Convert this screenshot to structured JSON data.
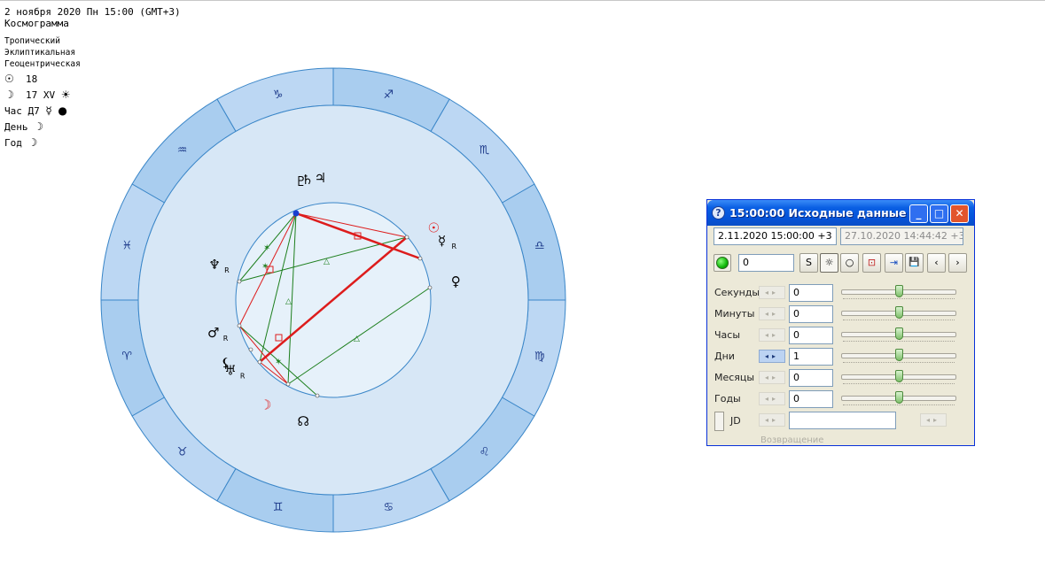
{
  "header": {
    "date_line": "2 ноября 2020  Пн  15:00 (GMT+3)",
    "chart_kind": "Космограмма",
    "zodiac": "Тропический",
    "coords": "Эклиптикальная",
    "center": "Геоцентрическая",
    "sun_line": {
      "glyph": "☉",
      "value": "18"
    },
    "moon_line": {
      "glyph": "☽",
      "value": "17 XV",
      "extra": "☀"
    },
    "hour_line": {
      "label": "Час Д7",
      "glyph": "☿",
      "dot": "●"
    },
    "day_line": {
      "label": "День",
      "glyph": "☽"
    },
    "year_line": {
      "label": "Год",
      "glyph": "☽"
    }
  },
  "wheel": {
    "signs": [
      {
        "name": "capricorn-icon",
        "glyph": "♑",
        "angle": 105
      },
      {
        "name": "sagittarius-icon",
        "glyph": "♐",
        "angle": 75
      },
      {
        "name": "scorpio-icon",
        "glyph": "♏",
        "angle": 45
      },
      {
        "name": "libra-icon",
        "glyph": "♎",
        "angle": 15
      },
      {
        "name": "virgo-icon",
        "glyph": "♍",
        "angle": -15
      },
      {
        "name": "leo-icon",
        "glyph": "♌",
        "angle": -45
      },
      {
        "name": "cancer-icon",
        "glyph": "♋",
        "angle": -75
      },
      {
        "name": "gemini-icon",
        "glyph": "♊",
        "angle": -105
      },
      {
        "name": "taurus-icon",
        "glyph": "♉",
        "angle": -135
      },
      {
        "name": "aries-icon",
        "glyph": "♈",
        "angle": -165
      },
      {
        "name": "pisces-icon",
        "glyph": "♓",
        "angle": 165
      },
      {
        "name": "aquarius-icon",
        "glyph": "♒",
        "angle": 135
      }
    ],
    "planets": [
      {
        "name": "pluto-icon",
        "glyph": "♇",
        "angle": 105,
        "color": "#000000"
      },
      {
        "name": "saturn-icon",
        "glyph": "♄",
        "angle": 102,
        "color": "#000000"
      },
      {
        "name": "jupiter-icon",
        "glyph": "♃",
        "angle": 96,
        "color": "#000000"
      },
      {
        "name": "sun-icon",
        "glyph": "☉",
        "angle": 36,
        "color": "#e02020"
      },
      {
        "name": "mercury-icon",
        "glyph": "☿",
        "angle": 29,
        "retro": "R",
        "color": "#000000"
      },
      {
        "name": "venus-icon",
        "glyph": "♀",
        "angle": 9,
        "color": "#000000"
      },
      {
        "name": "neptune-icon",
        "glyph": "♆",
        "angle": 163,
        "retro": "R",
        "color": "#000000"
      },
      {
        "name": "mars-icon",
        "glyph": "♂",
        "angle": 195,
        "retro": "R",
        "color": "#000000"
      },
      {
        "name": "lilith-icon",
        "glyph": "⚸",
        "angle": 210,
        "color": "#000000"
      },
      {
        "name": "uranus-icon",
        "glyph": "♅",
        "angle": 214,
        "retro": "R",
        "color": "#000000"
      },
      {
        "name": "moon-icon",
        "glyph": "☽",
        "angle": 237,
        "color": "#e02020"
      },
      {
        "name": "north-node-icon",
        "glyph": "☊",
        "angle": 256,
        "color": "#000000"
      }
    ],
    "colors": {
      "outer_ring": "#a9cdef",
      "outer_ring_alt": "#bcd7f3",
      "inner_band": "#d7e7f6",
      "center": "#e6f1fa",
      "line": "#3a86c8",
      "harmonious": "#1d7f1d",
      "tense": "#dd1c1c"
    }
  },
  "dialog": {
    "title": "15:00:00 Исходные данные",
    "date_value": "2.11.2020  15:00:00  +3",
    "ref_value": "27.10.2020  14:44:42  +3",
    "counter_value": "0",
    "toolbar": {
      "swap": "S",
      "sun": "☼",
      "circle": "○",
      "target": "⊡",
      "export": "⇥",
      "save": "💾",
      "prev": "‹",
      "next": "›"
    },
    "rows": [
      {
        "label": "Секунды",
        "value": "0",
        "level": 0.5
      },
      {
        "label": "Минуты",
        "value": "0",
        "level": 0.5
      },
      {
        "label": "Часы",
        "value": "0",
        "level": 0.5
      },
      {
        "label": "Дни",
        "value": "1",
        "level": 0.5
      },
      {
        "label": "Месяцы",
        "value": "0",
        "level": 0.5
      },
      {
        "label": "Годы",
        "value": "0",
        "level": 0.5
      }
    ],
    "jd_label": "JD",
    "cut_label": "Возвращение"
  }
}
